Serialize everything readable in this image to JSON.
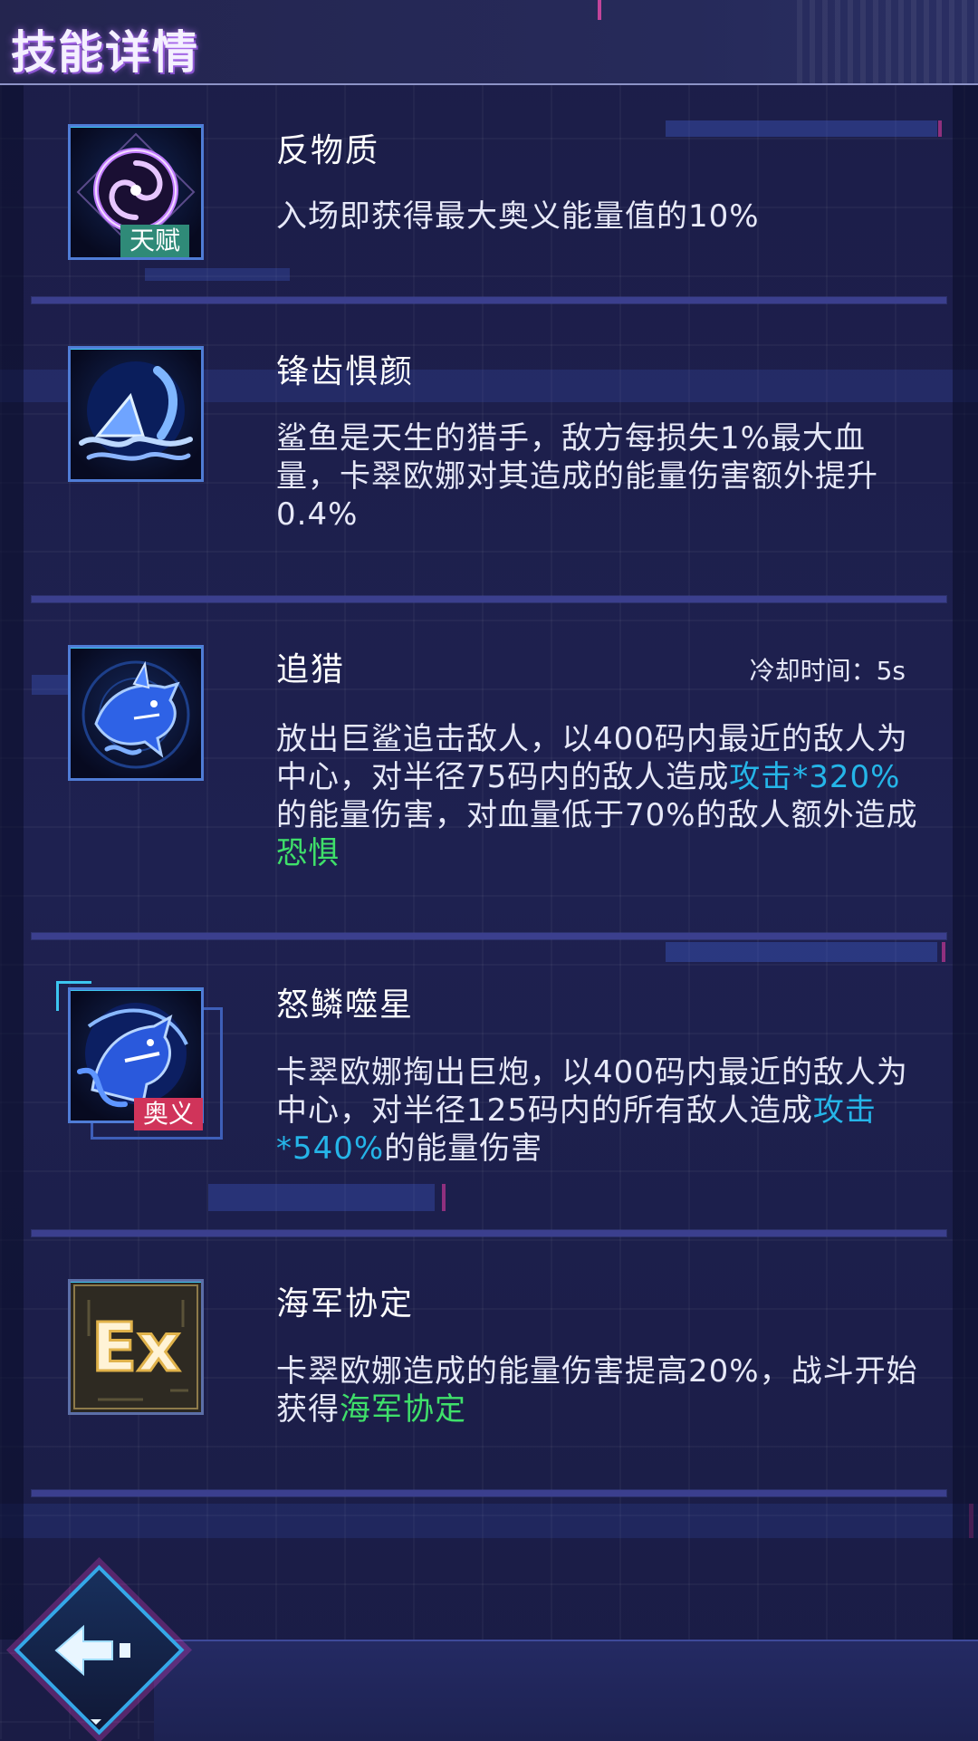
{
  "header": {
    "title": "技能详情"
  },
  "skills": [
    {
      "name": "反物质",
      "icon": "spiral-vortex-icon",
      "badge": "天赋",
      "desc_parts": [
        "入场即获得最大奥义能量值的10%"
      ]
    },
    {
      "name": "锋齿惧颜",
      "icon": "shark-fin-wave-icon",
      "desc_parts": [
        "鲨鱼是天生的猎手，敌方每损失1%最大血量，卡翠欧娜对其造成的能量伤害额外提升0.4%"
      ]
    },
    {
      "name": "追猎",
      "icon": "shark-hunter-icon",
      "cooldown": "冷却时间：5s",
      "desc_parts": [
        "放出巨鲨追击敌人，以400码内最近的敌人为中心，对半径75码内的敌人造成",
        "攻击*320%",
        "的能量伤害，对血量低于70%的敌人额外造成",
        "恐惧"
      ]
    },
    {
      "name": "怒鳞噬星",
      "icon": "shark-cannon-icon",
      "badge": "奥义",
      "desc_parts": [
        "卡翠欧娜掏出巨炮，以400码内最近的敌人为中心，对半径125码内的所有敌人造成",
        "攻击*540%",
        "的能量伤害"
      ]
    },
    {
      "name": "海军协定",
      "icon": "ex-icon",
      "icon_text": "Ex",
      "desc_parts": [
        "卡翠欧娜造成的能量伤害提高20%，战斗开始获得",
        "海军协定"
      ]
    }
  ],
  "colors": {
    "highlight_blue": "#25b5e8",
    "highlight_green": "#3fe06a",
    "talent_badge": "#2f8a78",
    "ult_badge": "#d0345a",
    "divider": "#3b3f8e"
  },
  "back_button": {
    "icon": "back-arrow-icon"
  }
}
